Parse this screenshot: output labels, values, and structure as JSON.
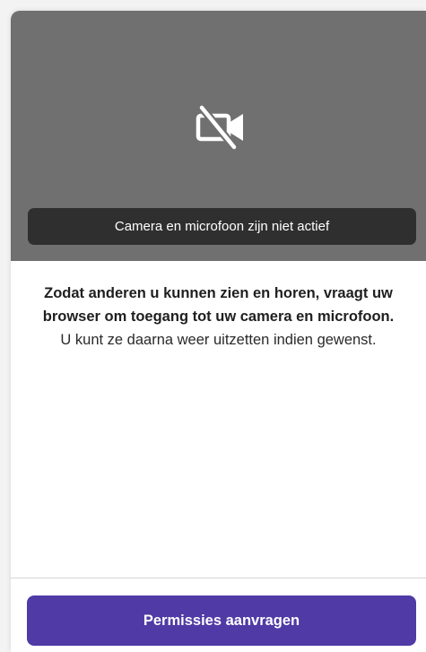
{
  "preview": {
    "icon": "camera-off-icon",
    "status_text": "Camera en microfoon zijn niet actief"
  },
  "message": {
    "bold_text": "Zodat anderen u kunnen zien en horen, vraagt uw browser om toegang tot uw camera en microfoon.",
    "normal_text": "U kunt ze daarna weer uitzetten indien gewenst."
  },
  "actions": {
    "request_permissions_label": "Permissies aanvragen"
  },
  "colors": {
    "preview_bg": "#707070",
    "status_bg": "#2f2f2f",
    "button_bg": "#4f3aa6"
  }
}
